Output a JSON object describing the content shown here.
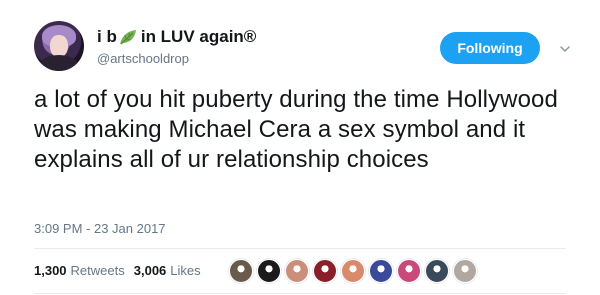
{
  "user": {
    "display_name_part1": "i b",
    "display_name_part2": "in LUV again®",
    "handle": "@artschooldrop",
    "name_icon": "leaf-icon"
  },
  "actions": {
    "follow_label": "Following",
    "menu_icon": "chevron-down-icon"
  },
  "tweet": {
    "text": "a lot of you hit puberty during the time Hollywood was making Michael Cera a sex symbol and it explains all of ur relationship choices",
    "timestamp": "3:09 PM - 23 Jan 2017"
  },
  "stats": {
    "retweets_count": "1,300",
    "retweets_label": "Retweets",
    "likes_count": "3,006",
    "likes_label": "Likes"
  },
  "likers": [
    {
      "color": "#6b5a4a"
    },
    {
      "color": "#1b1b1b"
    },
    {
      "color": "#c98f7a"
    },
    {
      "color": "#8a1f2a"
    },
    {
      "color": "#d98a6a"
    },
    {
      "color": "#3a4a9a"
    },
    {
      "color": "#c84a7a"
    },
    {
      "color": "#3b4a5a"
    },
    {
      "color": "#b0a8a0"
    }
  ],
  "colors": {
    "accent": "#1da1f2",
    "text": "#14171a",
    "secondary": "#657786",
    "leaf": "#77b255"
  }
}
